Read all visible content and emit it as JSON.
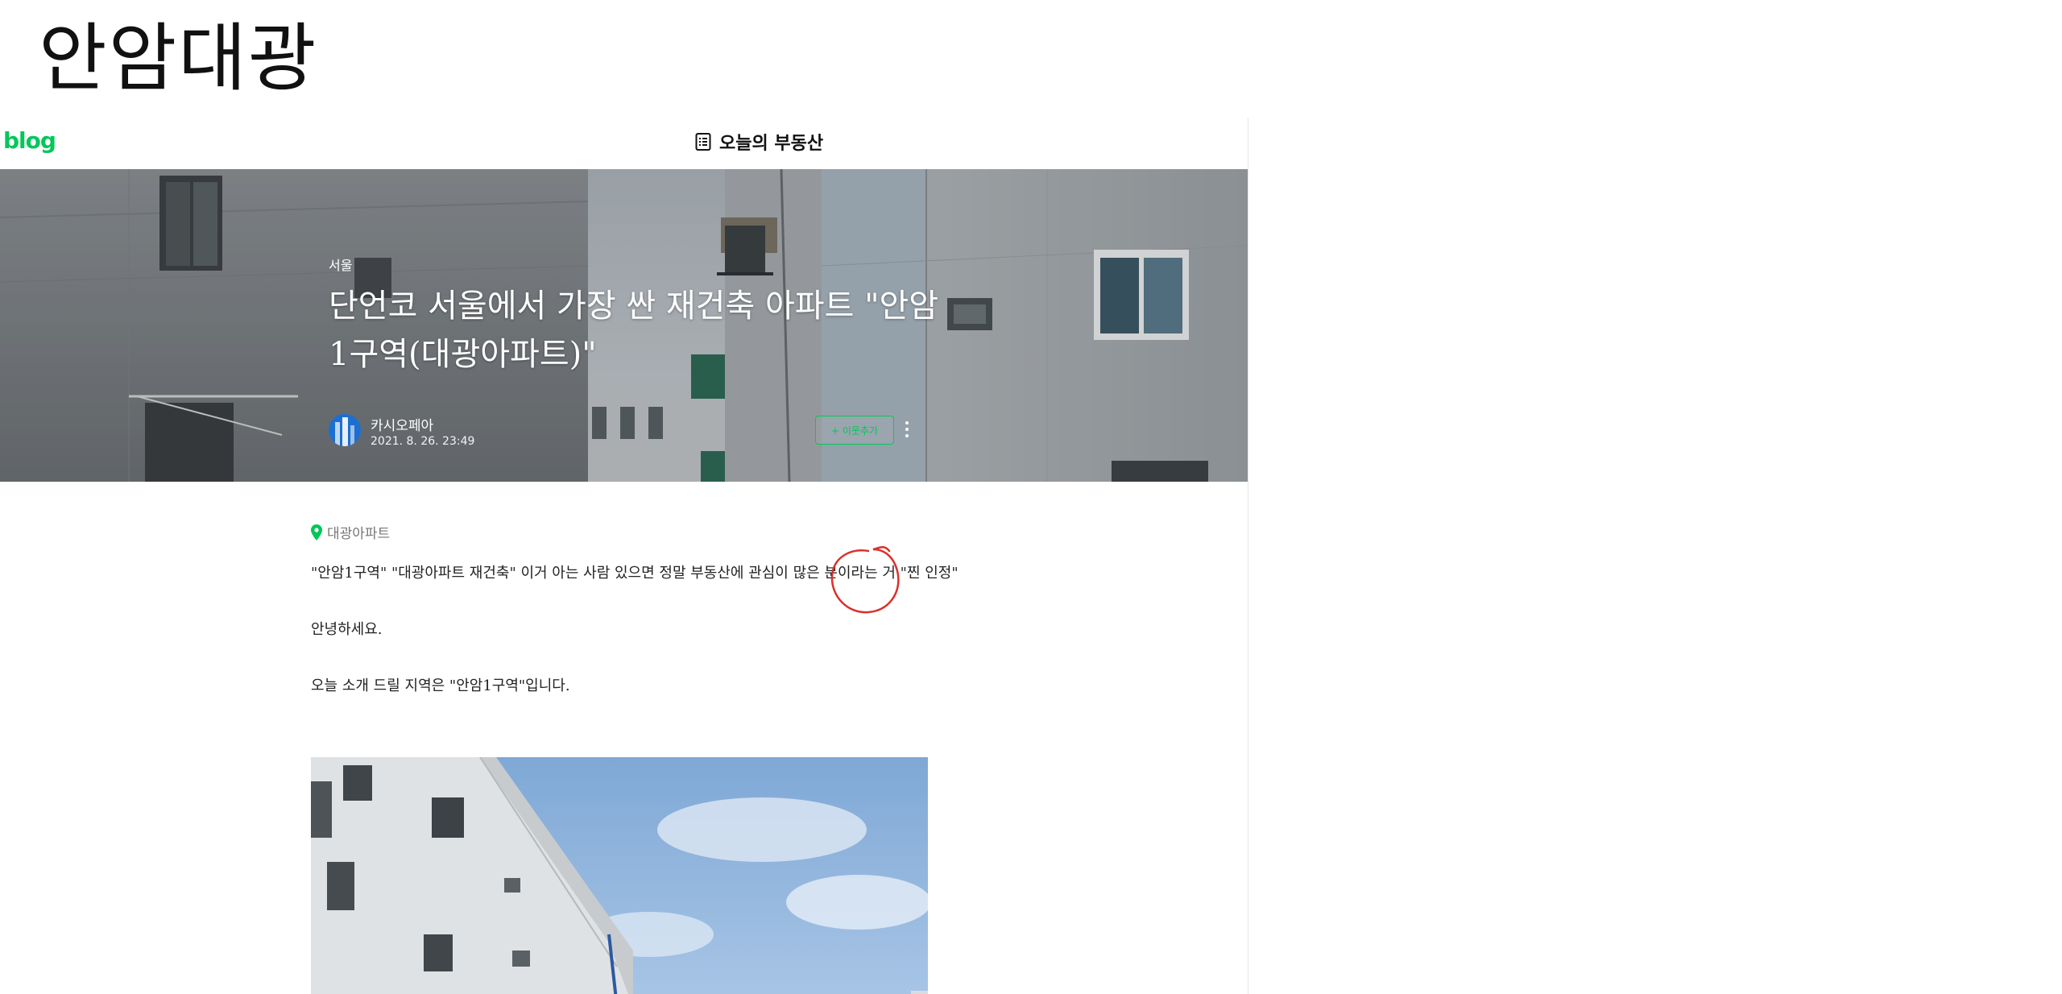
{
  "page_heading": "안암대광",
  "blog": {
    "logo": "blog",
    "name": "오늘의 부동산",
    "brand_color": "#03c75a"
  },
  "post": {
    "category": "서울",
    "title": "단언코 서울에서 가장 싼 재건축 아파트 \"안암1구역(대광아파트)\"",
    "author": "카시오페아",
    "date": "2021. 8. 26. 23:49",
    "neighbor_button": "+ 이웃추가",
    "place": "대광아파트",
    "paragraphs": [
      "\"안암1구역\" \"대광아파트 재건축\" 이거 아는 사람 있으면 정말 부동산에 관심이 많은 분이라는 거 \"찐 인정\"",
      "안녕하세요.",
      "오늘 소개 드릴 지역은 \"안암1구역\"입니다."
    ]
  },
  "annotation": {
    "type": "red-circle",
    "color": "#d9312b",
    "target_text": "\"찐 인정\""
  }
}
